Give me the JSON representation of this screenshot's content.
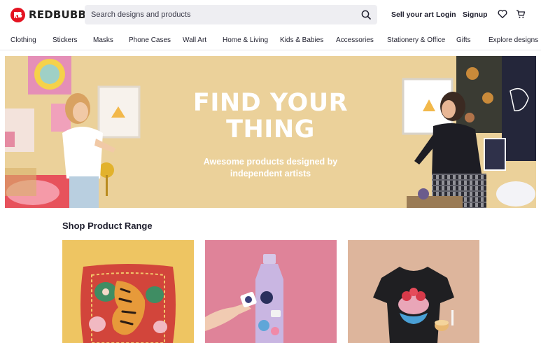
{
  "header": {
    "brand": "REDBUBBLE",
    "search_placeholder": "Search designs and products",
    "sell_label": "Sell your art",
    "login_label": "Login",
    "signup_label": "Signup"
  },
  "nav": {
    "items": [
      {
        "label": "Clothing"
      },
      {
        "label": "Stickers"
      },
      {
        "label": "Masks"
      },
      {
        "label": "Phone Cases"
      },
      {
        "label": "Wall Art"
      },
      {
        "label": "Home & Living"
      },
      {
        "label": "Kids & Babies"
      },
      {
        "label": "Accessories"
      },
      {
        "label": "Stationery & Office"
      },
      {
        "label": "Gifts"
      },
      {
        "label": "Explore designs"
      }
    ]
  },
  "hero": {
    "title_line1": "FIND YOUR",
    "title_line2": "THING",
    "subtitle_line1": "Awesome products designed by",
    "subtitle_line2": "independent artists"
  },
  "products": {
    "title": "Shop Product Range"
  },
  "colors": {
    "brand_red": "#e41321",
    "hero_bg": "#ebd19a",
    "text_dark": "#1e1e2d"
  },
  "icons": [
    "redbubble-logo-icon",
    "search-icon",
    "heart-icon",
    "cart-icon"
  ]
}
